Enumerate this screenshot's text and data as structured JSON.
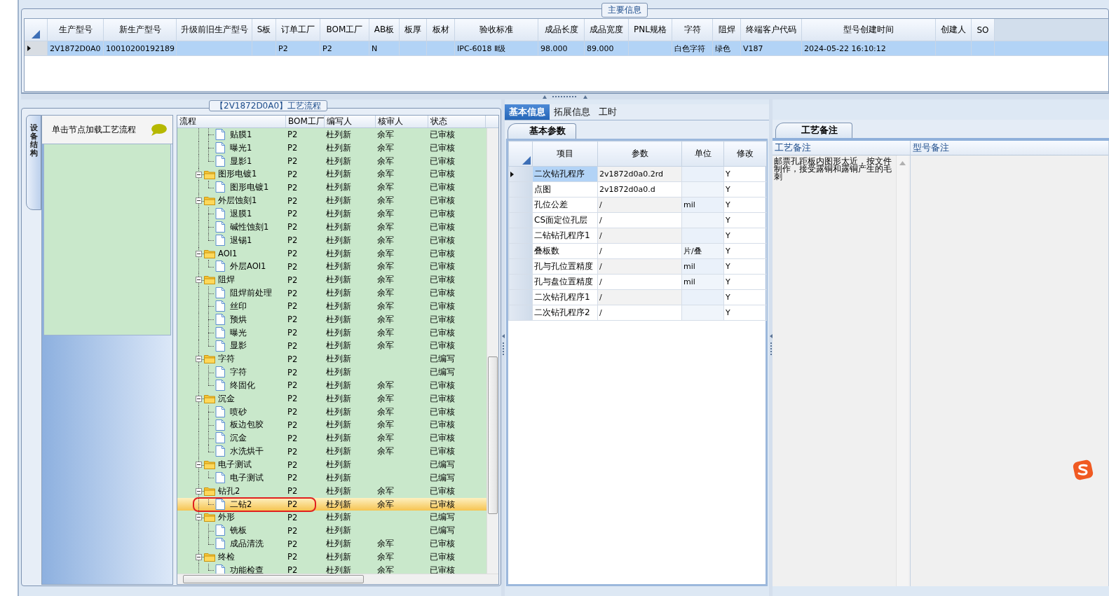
{
  "main_info": {
    "title": "主要信息",
    "columns": [
      "生产型号",
      "新生产型号",
      "升级前旧生产型号",
      "S板",
      "订单工厂",
      "BOM工厂",
      "AB板",
      "板厚",
      "板材",
      "验收标准",
      "成品长度",
      "成品宽度",
      "PNL规格",
      "字符",
      "阻焊",
      "终端客户代码",
      "型号创建时间",
      "创建人",
      "SO"
    ],
    "rows": [
      {
        "selected": true,
        "cells": [
          "2V1872D0A0",
          "10010200192189",
          null,
          null,
          "P2",
          "P2",
          "N",
          null,
          null,
          "IPC-6018 Ⅱ级",
          "98.000",
          "89.000",
          null,
          "白色字符",
          "绿色",
          "V187",
          "2024-05-22 16:10:12",
          null,
          null
        ]
      }
    ]
  },
  "flow": {
    "title": "【2V1872D0A0】工艺流程",
    "side_tab": "设备结构",
    "hint": "单击节点加载工艺流程",
    "tree": {
      "columns": [
        "流程",
        "BOM工厂",
        "编写人",
        "核审人",
        "状态"
      ],
      "continued_rows": [
        {
          "label": "贴膜1",
          "bom": "P2",
          "writer": "杜列新",
          "reviewer": "余军",
          "status": "已审核",
          "selected": false
        },
        {
          "label": "曝光1",
          "bom": "P2",
          "writer": "杜列新",
          "reviewer": "余军",
          "status": "已审核",
          "selected": false
        },
        {
          "label": "显影1",
          "bom": "P2",
          "writer": "杜列新",
          "reviewer": "余军",
          "status": "已审核",
          "selected": false
        }
      ],
      "nodes": [
        {
          "label": "图形电镀1",
          "bom": "P2",
          "writer": "杜列新",
          "reviewer": "余军",
          "status": "已审核",
          "selected": false,
          "expanded": true,
          "children": [
            {
              "label": "图形电镀1",
              "bom": "P2",
              "writer": "杜列新",
              "reviewer": "余军",
              "status": "已审核",
              "selected": false
            }
          ]
        },
        {
          "label": "外层蚀刻1",
          "bom": "P2",
          "writer": "杜列新",
          "reviewer": "余军",
          "status": "已审核",
          "selected": false,
          "expanded": true,
          "children": [
            {
              "label": "退膜1",
              "bom": "P2",
              "writer": "杜列新",
              "reviewer": "余军",
              "status": "已审核",
              "selected": false
            },
            {
              "label": "碱性蚀刻1",
              "bom": "P2",
              "writer": "杜列新",
              "reviewer": "余军",
              "status": "已审核",
              "selected": false
            },
            {
              "label": "退锡1",
              "bom": "P2",
              "writer": "杜列新",
              "reviewer": "余军",
              "status": "已审核",
              "selected": false
            }
          ]
        },
        {
          "label": "AOI1",
          "bom": "P2",
          "writer": "杜列新",
          "reviewer": "余军",
          "status": "已审核",
          "selected": false,
          "expanded": true,
          "children": [
            {
              "label": "外层AOI1",
              "bom": "P2",
              "writer": "杜列新",
              "reviewer": "余军",
              "status": "已审核",
              "selected": false
            }
          ]
        },
        {
          "label": "阻焊",
          "bom": "P2",
          "writer": "杜列新",
          "reviewer": "余军",
          "status": "已审核",
          "selected": false,
          "expanded": true,
          "children": [
            {
              "label": "阻焊前处理",
              "bom": "P2",
              "writer": "杜列新",
              "reviewer": "余军",
              "status": "已审核",
              "selected": false
            },
            {
              "label": "丝印",
              "bom": "P2",
              "writer": "杜列新",
              "reviewer": "余军",
              "status": "已审核",
              "selected": false
            },
            {
              "label": "预烘",
              "bom": "P2",
              "writer": "杜列新",
              "reviewer": "余军",
              "status": "已审核",
              "selected": false
            },
            {
              "label": "曝光",
              "bom": "P2",
              "writer": "杜列新",
              "reviewer": "余军",
              "status": "已审核",
              "selected": false
            },
            {
              "label": "显影",
              "bom": "P2",
              "writer": "杜列新",
              "reviewer": "余军",
              "status": "已审核",
              "selected": false
            }
          ]
        },
        {
          "label": "字符",
          "bom": "P2",
          "writer": "杜列新",
          "status": "已编写",
          "selected": false,
          "expanded": true,
          "children": [
            {
              "label": "字符",
              "bom": "P2",
              "writer": "杜列新",
              "status": "已编写",
              "selected": false
            },
            {
              "label": "终固化",
              "bom": "P2",
              "writer": "杜列新",
              "reviewer": "余军",
              "status": "已审核",
              "selected": false
            }
          ]
        },
        {
          "label": "沉金",
          "bom": "P2",
          "writer": "杜列新",
          "reviewer": "余军",
          "status": "已审核",
          "selected": false,
          "expanded": true,
          "children": [
            {
              "label": "喷砂",
              "bom": "P2",
              "writer": "杜列新",
              "reviewer": "余军",
              "status": "已审核",
              "selected": false
            },
            {
              "label": "板边包胶",
              "bom": "P2",
              "writer": "杜列新",
              "reviewer": "余军",
              "status": "已审核",
              "selected": false
            },
            {
              "label": "沉金",
              "bom": "P2",
              "writer": "杜列新",
              "reviewer": "余军",
              "status": "已审核",
              "selected": false
            },
            {
              "label": "水洗烘干",
              "bom": "P2",
              "writer": "杜列新",
              "reviewer": "余军",
              "status": "已审核",
              "selected": false
            }
          ]
        },
        {
          "label": "电子测试",
          "bom": "P2",
          "writer": "杜列新",
          "status": "已编写",
          "selected": false,
          "expanded": true,
          "children": [
            {
              "label": "电子测试",
              "bom": "P2",
              "writer": "杜列新",
              "status": "已编写",
              "selected": false
            }
          ]
        },
        {
          "label": "钻孔2",
          "bom": "P2",
          "writer": "杜列新",
          "reviewer": "余军",
          "status": "已审核",
          "selected": false,
          "expanded": true,
          "children": [
            {
              "label": "二钻2",
              "bom": "P2",
              "writer": "杜列新",
              "reviewer": "余军",
              "status": "已审核",
              "selected": true,
              "circled": true
            }
          ]
        },
        {
          "label": "外形",
          "bom": "P2",
          "writer": "杜列新",
          "status": "已编写",
          "selected": false,
          "expanded": true,
          "children": [
            {
              "label": "铣板",
              "bom": "P2",
              "writer": "杜列新",
              "status": "已编写",
              "selected": false
            },
            {
              "label": "成品清洗",
              "bom": "P2",
              "writer": "杜列新",
              "reviewer": "余军",
              "status": "已审核",
              "selected": false
            }
          ]
        },
        {
          "label": "终检",
          "bom": "P2",
          "writer": "杜列新",
          "reviewer": "余军",
          "status": "已审核",
          "selected": false,
          "expanded": true,
          "children": [
            {
              "label": "功能检查",
              "bom": "P2",
              "writer": "杜列新",
              "reviewer": "余军",
              "status": "已审核",
              "selected": false
            }
          ]
        }
      ]
    }
  },
  "params": {
    "tabs": [
      {
        "label": "基本信息",
        "selected": true
      },
      {
        "label": "拓展信息",
        "selected": false
      },
      {
        "label": "工时",
        "selected": false
      }
    ],
    "sub_tab": "基本参数",
    "columns": [
      "项目",
      "参数",
      "单位",
      "修改"
    ],
    "rows": [
      {
        "item": "二次钻孔程序",
        "value": "2v1872d0a0.2rd",
        "unit": null,
        "modify": "Y",
        "selected": true
      },
      {
        "item": "点图",
        "value": "2v1872d0a0.d",
        "unit": null,
        "modify": "Y",
        "selected": false
      },
      {
        "item": "孔位公差",
        "value": "/",
        "unit": "mil",
        "modify": "Y",
        "selected": false
      },
      {
        "item": "CS面定位孔层",
        "value": "/",
        "unit": null,
        "modify": "Y",
        "selected": false
      },
      {
        "item": "二钻钻孔程序1",
        "value": "/",
        "unit": null,
        "modify": "Y",
        "selected": false
      },
      {
        "item": "叠板数",
        "value": "/",
        "unit": "片/叠",
        "modify": "Y",
        "selected": false
      },
      {
        "item": "孔与孔位置精度",
        "value": "/",
        "unit": "mil",
        "modify": "Y",
        "selected": false
      },
      {
        "item": "孔与盘位置精度",
        "value": "/",
        "unit": "mil",
        "modify": "Y",
        "selected": false
      },
      {
        "item": "二次钻孔程序1",
        "value": "/",
        "unit": null,
        "modify": "Y",
        "selected": false
      },
      {
        "item": "二次钻孔程序2",
        "value": "/",
        "unit": null,
        "modify": "Y",
        "selected": false
      }
    ]
  },
  "remarks": {
    "tab": "工艺备注",
    "columns": [
      {
        "title": "工艺备注",
        "text": "邮票孔距板内图形太近，按文件制作，接受露铜和露铜产生的毛刺"
      },
      {
        "title": "型号备注"
      }
    ]
  }
}
